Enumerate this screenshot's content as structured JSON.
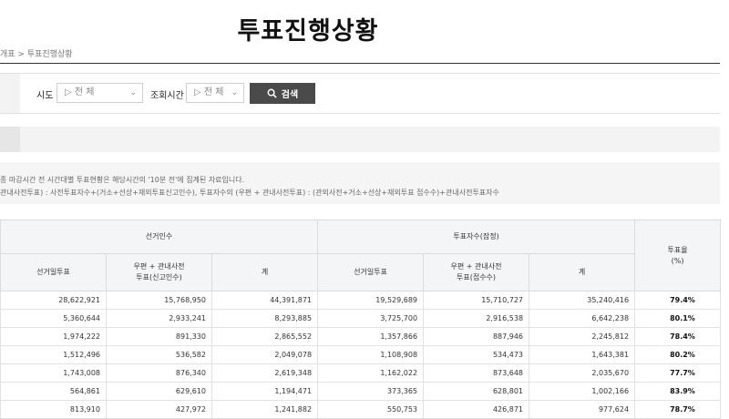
{
  "page": {
    "title": "투표진행상황",
    "breadcrumb": "개표 > 투표진행상황"
  },
  "search": {
    "sido_label": "시도",
    "sido_value": "▷ 전 체",
    "time_label": "조회시간",
    "time_value": "▷ 전 체",
    "button_label": "검색"
  },
  "notes": {
    "line1": "종 마감시간 전 시간대별 투표현황은 해당시간의 '10분 전'에 집계된 자료입니다.",
    "line2": "관내사전투표) : 사전투표자수+(거소+선상+재외투표신고인수), 투표자수의 (우편 + 관내사전투표) : (관외사전+거소+선상+재외투표 접수수)+관내사전투표자수"
  },
  "table": {
    "group_headers": {
      "electors": "선거인수",
      "voters": "투표자수(잠정)",
      "rate": "투표율\n(%)"
    },
    "sub_headers": {
      "election_day": "선거일투표",
      "postal_electors": "우편 + 관내사전\n투표(신고인수)",
      "total": "계",
      "election_day_v": "선거일투표",
      "postal_voters": "우편 + 관내사전\n투표(접수수)",
      "total_v": "계"
    },
    "rows": [
      {
        "eday": "28,622,921",
        "postal": "15,768,950",
        "total": "44,391,871",
        "v_eday": "19,529,689",
        "v_postal": "15,710,727",
        "v_total": "35,240,416",
        "rate": "79.4%"
      },
      {
        "eday": "5,360,644",
        "postal": "2,933,241",
        "total": "8,293,885",
        "v_eday": "3,725,700",
        "v_postal": "2,916,538",
        "v_total": "6,642,238",
        "rate": "80.1%"
      },
      {
        "eday": "1,974,222",
        "postal": "891,330",
        "total": "2,865,552",
        "v_eday": "1,357,866",
        "v_postal": "887,946",
        "v_total": "2,245,812",
        "rate": "78.4%"
      },
      {
        "eday": "1,512,496",
        "postal": "536,582",
        "total": "2,049,078",
        "v_eday": "1,108,908",
        "v_postal": "534,473",
        "v_total": "1,643,381",
        "rate": "80.2%"
      },
      {
        "eday": "1,743,008",
        "postal": "876,340",
        "total": "2,619,348",
        "v_eday": "1,162,022",
        "v_postal": "873,648",
        "v_total": "2,035,670",
        "rate": "77.7%"
      },
      {
        "eday": "564,861",
        "postal": "629,610",
        "total": "1,194,471",
        "v_eday": "373,365",
        "v_postal": "628,801",
        "v_total": "1,002,166",
        "rate": "83.9%"
      },
      {
        "eday": "813,910",
        "postal": "427,972",
        "total": "1,241,882",
        "v_eday": "550,753",
        "v_postal": "426,871",
        "v_total": "977,624",
        "rate": "78.7%"
      }
    ]
  }
}
